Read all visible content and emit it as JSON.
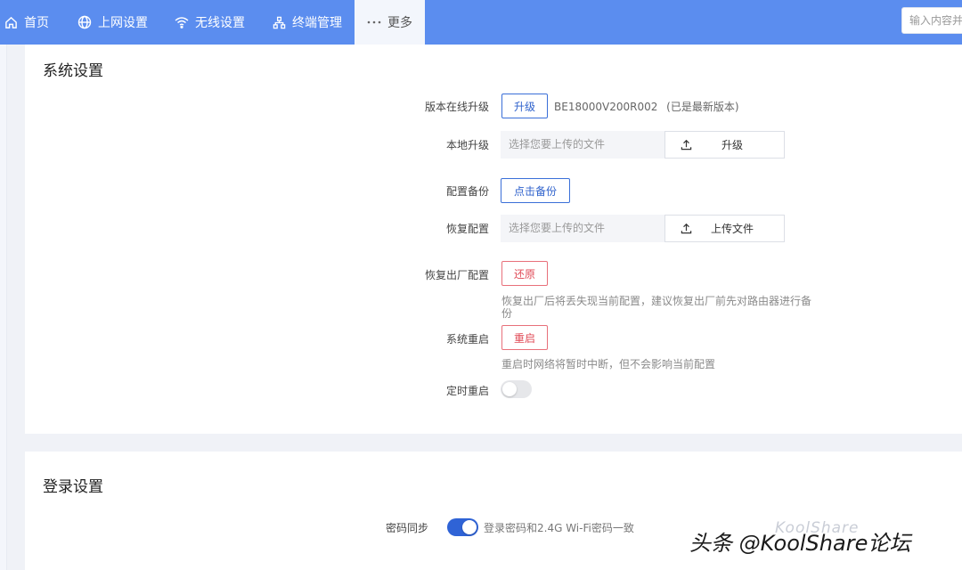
{
  "nav": {
    "items": [
      {
        "label": "首页",
        "icon": "home-icon"
      },
      {
        "label": "上网设置",
        "icon": "globe-icon"
      },
      {
        "label": "无线设置",
        "icon": "wifi-icon"
      },
      {
        "label": "终端管理",
        "icon": "devices-icon"
      },
      {
        "label": "更多",
        "icon": "more-icon"
      }
    ],
    "search_placeholder": "输入内容并"
  },
  "system": {
    "title": "系统设置",
    "online_upgrade": {
      "label": "版本在线升级",
      "button": "升级",
      "version": "BE18000V200R002",
      "status": "(已是最新版本)"
    },
    "local_upgrade": {
      "label": "本地升级",
      "placeholder": "选择您要上传的文件",
      "button": "升级"
    },
    "backup": {
      "label": "配置备份",
      "button": "点击备份"
    },
    "restore": {
      "label": "恢复配置",
      "placeholder": "选择您要上传的文件",
      "button": "上传文件"
    },
    "factory_reset": {
      "label": "恢复出厂配置",
      "button": "还原",
      "hint": "恢复出厂后将丢失现当前配置，建议恢复出厂前先对路由器进行备份"
    },
    "reboot": {
      "label": "系统重启",
      "button": "重启",
      "hint": "重启时网络将暂时中断，但不会影响当前配置"
    },
    "scheduled_reboot": {
      "label": "定时重启",
      "enabled": false
    }
  },
  "login": {
    "title": "登录设置",
    "password_sync": {
      "label": "密码同步",
      "enabled": true,
      "description": "登录密码和2.4G Wi-Fi密码一致"
    }
  },
  "watermark": {
    "faint": "KoolShare",
    "main": "头条 @KoolShare论坛"
  },
  "colors": {
    "nav_bg": "#5b8def",
    "primary": "#2f62cc",
    "danger": "#e04b57"
  }
}
